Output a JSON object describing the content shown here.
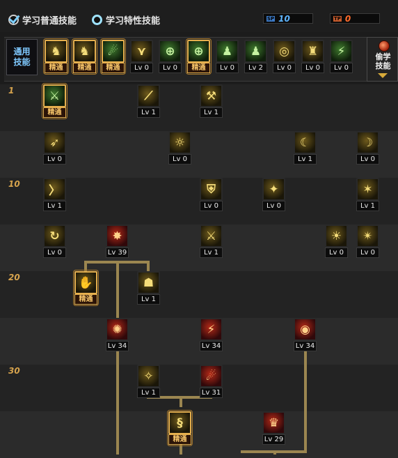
{
  "header": {
    "tab_common": "学习普通技能",
    "tab_trait": "学习特性技能",
    "sp_counters": [
      {
        "tag": "SP",
        "value": "10",
        "tag_color": "#3c79c4",
        "value_color": "#5eb5ff"
      },
      {
        "tag": "TP",
        "value": "0",
        "tag_color": "#c45a2c",
        "value_color": "#ff6a2a"
      }
    ]
  },
  "common": {
    "title": "通用\n技能",
    "skills": [
      {
        "label": "精通",
        "master": true,
        "tone": "gold",
        "icon": "sitting-figure-icon",
        "glyph": "♞"
      },
      {
        "label": "精通",
        "master": true,
        "tone": "gold",
        "icon": "running-figure-icon",
        "glyph": "♞"
      },
      {
        "label": "精通",
        "master": true,
        "tone": "green",
        "icon": "dash-figure-icon",
        "glyph": "☄"
      },
      {
        "label": "Lv 0",
        "master": false,
        "tone": "gold",
        "icon": "wings-icon",
        "glyph": "⋎"
      },
      {
        "label": "Lv 0",
        "master": false,
        "tone": "green",
        "icon": "crosshair-icon",
        "glyph": "⊕"
      },
      {
        "label": "精通",
        "master": true,
        "tone": "green",
        "icon": "crosshair-icon",
        "glyph": "⊕"
      },
      {
        "label": "Lv 0",
        "master": false,
        "tone": "green",
        "icon": "crouch-figure-icon",
        "glyph": "♟"
      },
      {
        "label": "Lv 2",
        "master": false,
        "tone": "green",
        "icon": "kneel-figure-icon",
        "glyph": "♟"
      },
      {
        "label": "Lv 0",
        "master": false,
        "tone": "gold",
        "icon": "vortex-icon",
        "glyph": "◎"
      },
      {
        "label": "Lv 0",
        "master": false,
        "tone": "gold",
        "icon": "warrior-icon",
        "glyph": "♜"
      },
      {
        "label": "Lv 0",
        "master": false,
        "tone": "green",
        "icon": "slash-figure-icon",
        "glyph": "⚡"
      }
    ],
    "right_button": "偷学\n技能"
  },
  "rows": [
    {
      "level": "1",
      "stripe": "#232323"
    },
    {
      "level": "",
      "stripe": "#2b2b2b"
    },
    {
      "level": "10",
      "stripe": "#232323"
    },
    {
      "level": "",
      "stripe": "#2b2b2b"
    },
    {
      "level": "20",
      "stripe": "#232323"
    },
    {
      "level": "",
      "stripe": "#2b2b2b"
    },
    {
      "level": "30",
      "stripe": "#232323"
    },
    {
      "level": "",
      "stripe": "#2b2b2b"
    }
  ],
  "tree": [
    {
      "row": 0,
      "col": 0,
      "label": "精通",
      "master": true,
      "tone": "green",
      "icon": "slash-marks-icon",
      "glyph": "⚔"
    },
    {
      "row": 0,
      "col": 3,
      "label": "Lv 1",
      "master": false,
      "tone": "gold",
      "icon": "kunai-icon",
      "glyph": "⟋"
    },
    {
      "row": 0,
      "col": 5,
      "label": "Lv 1",
      "master": false,
      "tone": "gold",
      "icon": "mallet-icon",
      "glyph": "⚒"
    },
    {
      "row": 1,
      "col": 0,
      "label": "Lv 0",
      "master": false,
      "tone": "gold",
      "icon": "sprint-figure-icon",
      "glyph": "➶"
    },
    {
      "row": 1,
      "col": 4,
      "label": "Lv 0",
      "master": false,
      "tone": "gold",
      "icon": "fireball-icon",
      "glyph": "☼"
    },
    {
      "row": 1,
      "col": 8,
      "label": "Lv 1",
      "master": false,
      "tone": "gold",
      "icon": "dragon-icon",
      "glyph": "☾"
    },
    {
      "row": 1,
      "col": 10,
      "label": "Lv 0",
      "master": false,
      "tone": "gold",
      "icon": "crescent-slash-icon",
      "glyph": "☽"
    },
    {
      "row": 2,
      "col": 0,
      "label": "Lv 1",
      "master": false,
      "tone": "gold",
      "icon": "wind-slash-icon",
      "glyph": "〉"
    },
    {
      "row": 2,
      "col": 5,
      "label": "Lv 0",
      "master": false,
      "tone": "gold",
      "icon": "shield-icon",
      "glyph": "⛨"
    },
    {
      "row": 2,
      "col": 7,
      "label": "Lv 0",
      "master": false,
      "tone": "gold",
      "icon": "tumble-figure-icon",
      "glyph": "✦"
    },
    {
      "row": 2,
      "col": 10,
      "label": "Lv 1",
      "master": false,
      "tone": "gold",
      "icon": "burst-slash-icon",
      "glyph": "✶"
    },
    {
      "row": 3,
      "col": 0,
      "label": "Lv 0",
      "master": false,
      "tone": "gold",
      "icon": "spin-kick-icon",
      "glyph": "↻"
    },
    {
      "row": 3,
      "col": 2,
      "label": "Lv 39",
      "master": false,
      "tone": "red",
      "icon": "flame-claw-icon",
      "glyph": "✸"
    },
    {
      "row": 3,
      "col": 5,
      "label": "Lv 1",
      "master": false,
      "tone": "gold",
      "icon": "flame-blade-icon",
      "glyph": "⚔"
    },
    {
      "row": 3,
      "col": 9,
      "label": "Lv 0",
      "master": false,
      "tone": "gold",
      "icon": "aura-figure-icon",
      "glyph": "☀"
    },
    {
      "row": 3,
      "col": 10,
      "label": "Lv 0",
      "master": false,
      "tone": "gold",
      "icon": "multi-blade-icon",
      "glyph": "✴"
    },
    {
      "row": 4,
      "col": 1,
      "label": "精通",
      "master": true,
      "tone": "gold",
      "icon": "hand-sign-icon",
      "glyph": "✋"
    },
    {
      "row": 4,
      "col": 3,
      "label": "Lv 1",
      "master": false,
      "tone": "gold",
      "icon": "ninja-face-icon",
      "glyph": "☗"
    },
    {
      "row": 5,
      "col": 2,
      "label": "Lv 34",
      "master": false,
      "tone": "red",
      "icon": "web-seal-icon",
      "glyph": "✺"
    },
    {
      "row": 5,
      "col": 5,
      "label": "Lv 34",
      "master": false,
      "tone": "red",
      "icon": "claw-strike-icon",
      "glyph": "⚡"
    },
    {
      "row": 5,
      "col": 8,
      "label": "Lv 34",
      "master": false,
      "tone": "red",
      "icon": "eye-seal-icon",
      "glyph": "◉"
    },
    {
      "row": 6,
      "col": 3,
      "label": "Lv 1",
      "master": false,
      "tone": "gold",
      "icon": "light-burst-icon",
      "glyph": "✧"
    },
    {
      "row": 6,
      "col": 5,
      "label": "Lv 31",
      "master": false,
      "tone": "red",
      "icon": "fire-dragon-icon",
      "glyph": "☄"
    },
    {
      "row": 7,
      "col": 4,
      "label": "精通",
      "master": true,
      "tone": "gold",
      "icon": "spiral-icon",
      "glyph": "§"
    },
    {
      "row": 7,
      "col": 7,
      "label": "Lv 29",
      "master": false,
      "tone": "red",
      "icon": "demon-mask-icon",
      "glyph": "♛"
    }
  ]
}
